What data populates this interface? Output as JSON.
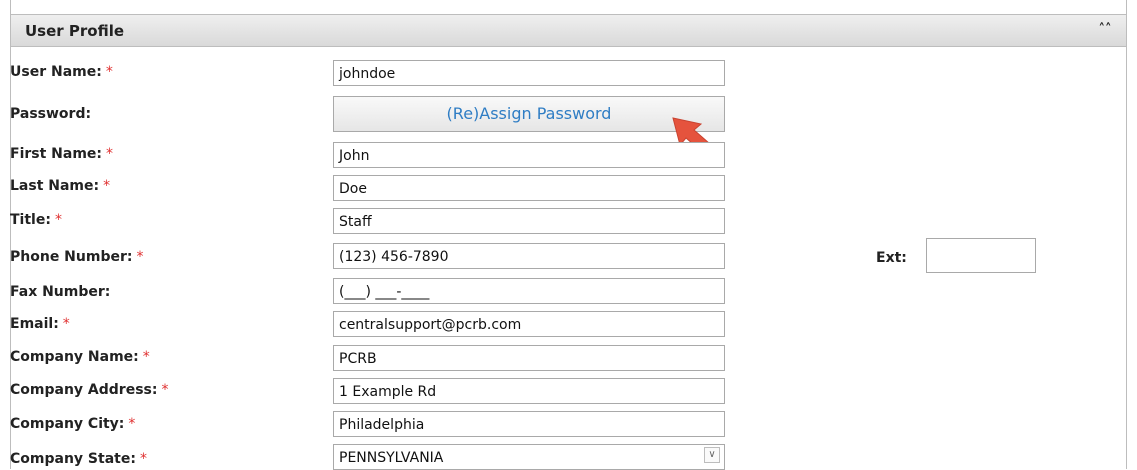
{
  "panel": {
    "title": "User Profile",
    "collapse_icon": "double-chevron-up-icon"
  },
  "required_mark": "*",
  "fields": {
    "user_name": {
      "label": "User Name:",
      "value": "johndoe"
    },
    "password": {
      "label": "Password:",
      "button": "(Re)Assign Password"
    },
    "first_name": {
      "label": "First Name:",
      "value": "John"
    },
    "last_name": {
      "label": "Last Name:",
      "value": "Doe"
    },
    "title": {
      "label": "Title:",
      "value": "Staff"
    },
    "phone": {
      "label": "Phone Number:",
      "value": "(123) 456-7890",
      "ext_label": "Ext:",
      "ext_value": ""
    },
    "fax": {
      "label": "Fax Number:",
      "value": "(___) ___-____"
    },
    "email": {
      "label": "Email:",
      "value": "centralsupport@pcrb.com"
    },
    "company_name": {
      "label": "Company Name:",
      "value": "PCRB"
    },
    "company_address": {
      "label": "Company Address:",
      "value": "1 Example Rd"
    },
    "company_city": {
      "label": "Company City:",
      "value": "Philadelphia"
    },
    "company_state": {
      "label": "Company State:",
      "value": "PENNSYLVANIA"
    }
  },
  "colors": {
    "required": "#e03030",
    "button_text": "#2f7dc4",
    "arrow": "#e5533d"
  }
}
